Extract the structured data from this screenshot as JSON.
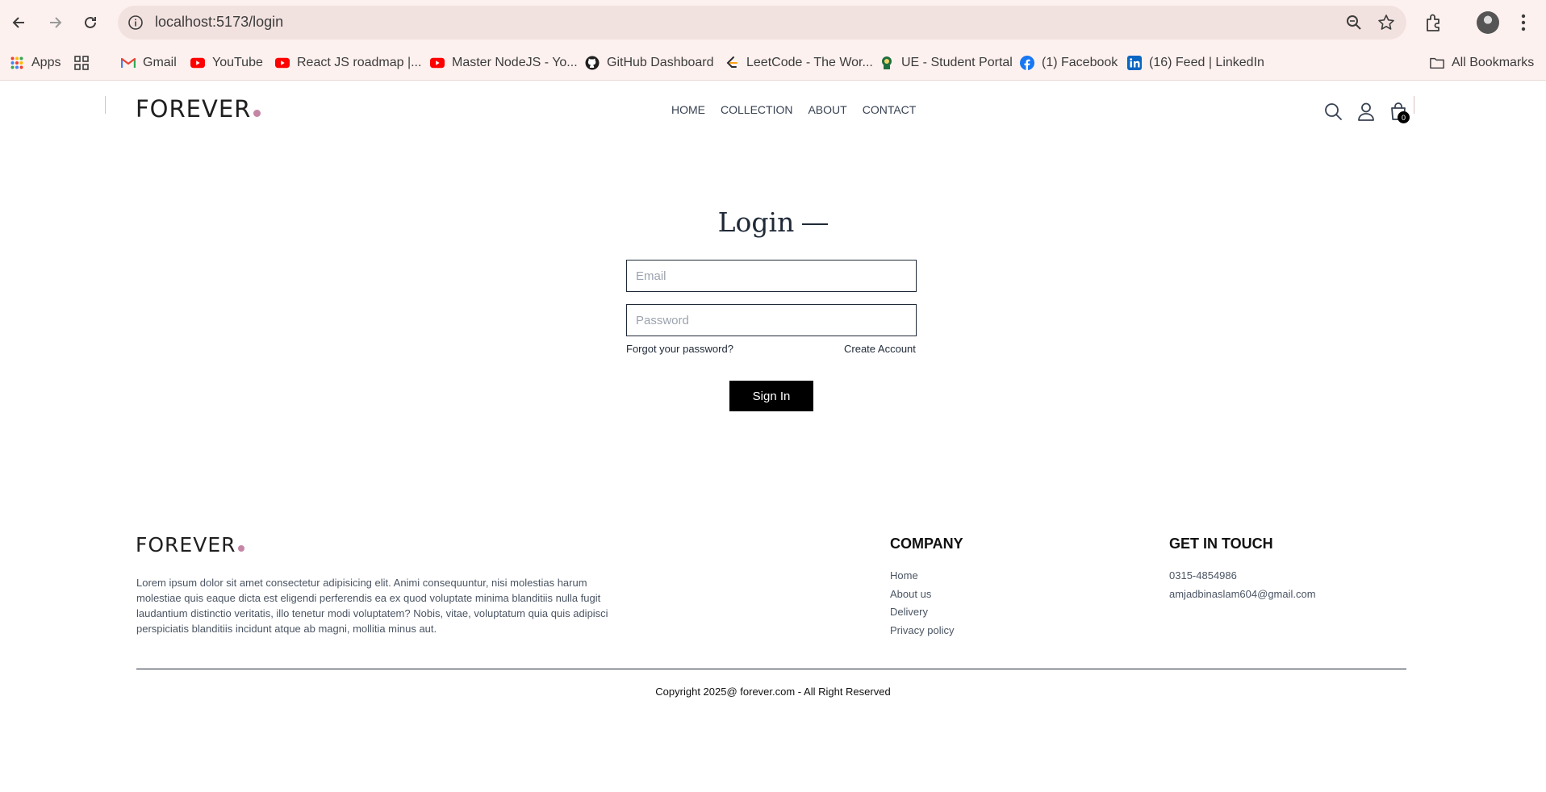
{
  "browser": {
    "url": "localhost:5173/login",
    "bookmarks": [
      {
        "label": "Apps",
        "icon": "apps-grid-icon"
      },
      {
        "label": "",
        "icon": "tab-groups-icon"
      },
      {
        "label": "Gmail",
        "icon": "gmail-icon"
      },
      {
        "label": "YouTube",
        "icon": "youtube-icon"
      },
      {
        "label": "React JS roadmap |...",
        "icon": "youtube-icon"
      },
      {
        "label": "Master NodeJS - Yo...",
        "icon": "youtube-icon"
      },
      {
        "label": "GitHub Dashboard",
        "icon": "github-icon"
      },
      {
        "label": "LeetCode - The Wor...",
        "icon": "leetcode-icon"
      },
      {
        "label": "UE - Student Portal",
        "icon": "ue-icon"
      },
      {
        "label": "(1) Facebook",
        "icon": "facebook-icon"
      },
      {
        "label": "(16) Feed | LinkedIn",
        "icon": "linkedin-icon"
      },
      {
        "label": "All Bookmarks",
        "icon": "folder-icon"
      }
    ]
  },
  "header": {
    "logo": "FOREVER",
    "nav": [
      "HOME",
      "COLLECTION",
      "ABOUT",
      "CONTACT"
    ],
    "cart_count": "0"
  },
  "login": {
    "title": "Login",
    "email_placeholder": "Email",
    "password_placeholder": "Password",
    "forgot": "Forgot your password?",
    "create": "Create Account",
    "submit": "Sign In"
  },
  "footer": {
    "logo": "FOREVER",
    "about": "Lorem ipsum dolor sit amet consectetur adipisicing elit. Animi consequuntur, nisi molestias harum molestiae quis eaque dicta est eligendi perferendis ea ex quod voluptate minima blanditiis nulla fugit laudantium distinctio veritatis, illo tenetur modi voluptatem? Nobis, vitae, voluptatum quia quis adipisci perspiciatis blanditiis incidunt atque ab magni, mollitia minus aut.",
    "company_heading": "COMPANY",
    "company_links": [
      "Home",
      "About us",
      "Delivery",
      "Privacy policy"
    ],
    "contact_heading": "GET IN TOUCH",
    "phone": "0315-4854986",
    "email": "amjadbinaslam604@gmail.com",
    "copyright": "Copyright 2025@ forever.com - All Right Reserved"
  },
  "colors": {
    "brand_dot": "#c586a5",
    "chrome_bg": "#fdf1ef",
    "button_bg": "#000000"
  }
}
